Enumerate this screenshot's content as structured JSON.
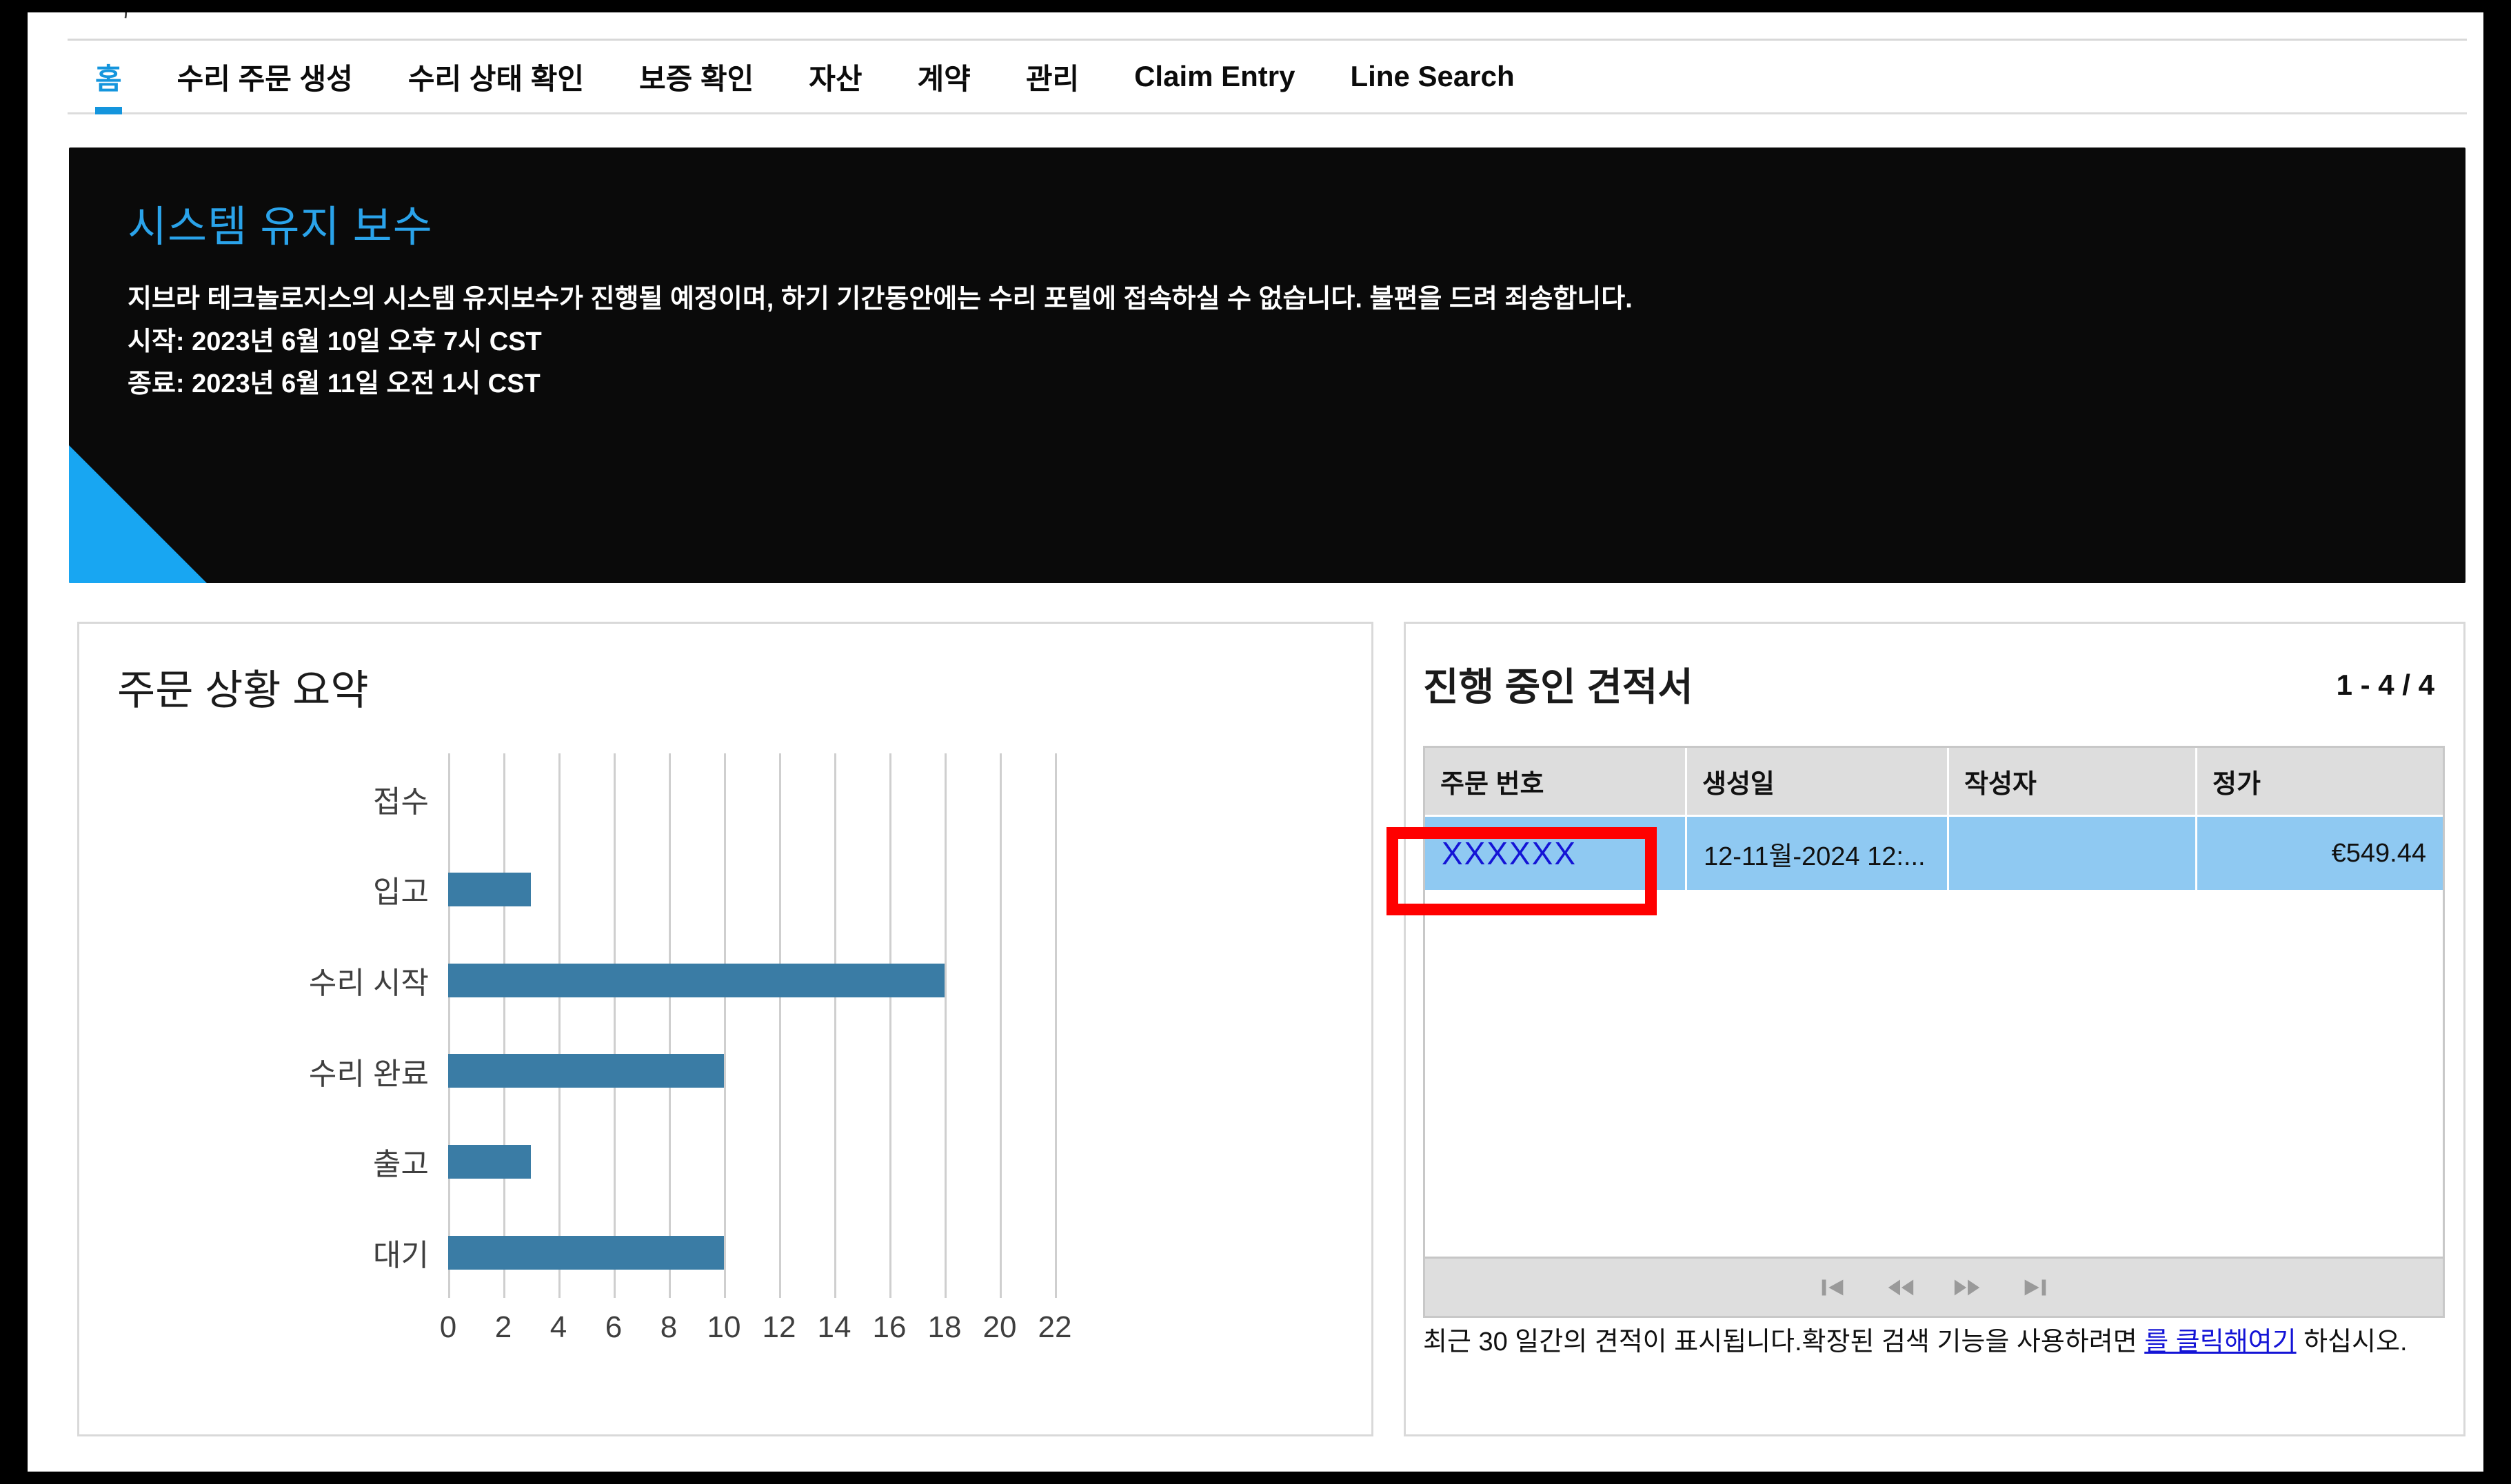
{
  "top_clip_text": "ᄀ",
  "nav": {
    "items": [
      {
        "label": "홈",
        "active": true
      },
      {
        "label": "수리 주문 생성",
        "active": false
      },
      {
        "label": "수리 상태 확인",
        "active": false
      },
      {
        "label": "보증 확인",
        "active": false
      },
      {
        "label": "자산",
        "active": false
      },
      {
        "label": "계약",
        "active": false
      },
      {
        "label": "관리",
        "active": false
      },
      {
        "label": "Claim Entry",
        "active": false
      },
      {
        "label": "Line Search",
        "active": false
      }
    ],
    "accent_color": "#1495dd"
  },
  "banner": {
    "title": "시스템 유지 보수",
    "lines": [
      "지브라 테크놀로지스의 시스템 유지보수가 진행될 예정이며, 하기 기간동안에는 수리 포털에 접속하실 수 없습니다. 불편을 드려 죄송합니다.",
      "시작: 2023년 6월 10일 오후 7시 CST",
      "종료: 2023년 6월 11일 오전 1시 CST"
    ],
    "dots": [
      {
        "state": "dim"
      },
      {
        "state": "light"
      },
      {
        "state": "light"
      }
    ],
    "background_color": "#0a0a0a",
    "title_color": "#2aa3ea",
    "corner_color": "#18a6f2"
  },
  "chart_card": {
    "title": "주문 상황 요약"
  },
  "chart_data": {
    "type": "bar",
    "orientation": "horizontal",
    "title": "주문 상황 요약",
    "categories": [
      "접수",
      "입고",
      "수리 시작",
      "수리 완료",
      "출고",
      "대기"
    ],
    "values": [
      0,
      3,
      18,
      10,
      3,
      10
    ],
    "xticks": [
      0,
      2,
      4,
      6,
      8,
      10,
      12,
      14,
      16,
      18,
      20,
      22
    ],
    "xlim": [
      0,
      22
    ],
    "xlabel": "",
    "ylabel": "",
    "grid": true,
    "legend": false,
    "bar_color": "#3a7ca5"
  },
  "quotes_card": {
    "title": "진행 중인 견적서",
    "paging_count": "1 - 4 / 4",
    "columns": [
      "주문 번호",
      "생성일",
      "작성자",
      "정가"
    ],
    "rows": [
      {
        "order_no": "XXXXXX",
        "created": "12-11월-2024 12:...",
        "author": "",
        "price": "€549.44"
      }
    ],
    "pager": [
      {
        "icon": "first-page-icon"
      },
      {
        "icon": "prev-page-icon"
      },
      {
        "icon": "next-page-icon"
      },
      {
        "icon": "last-page-icon"
      }
    ],
    "note_part1": "최근 30 일간의 견적이 표시됩니다.확장된 검색 기능을 사용하려면 ",
    "note_link": "를 클릭해여기",
    "note_part2": " 하십시오.",
    "row_highlight_color": "#8fc9f2",
    "header_color": "#dddddd"
  },
  "annotation": {
    "box_color": "#ff0000"
  }
}
